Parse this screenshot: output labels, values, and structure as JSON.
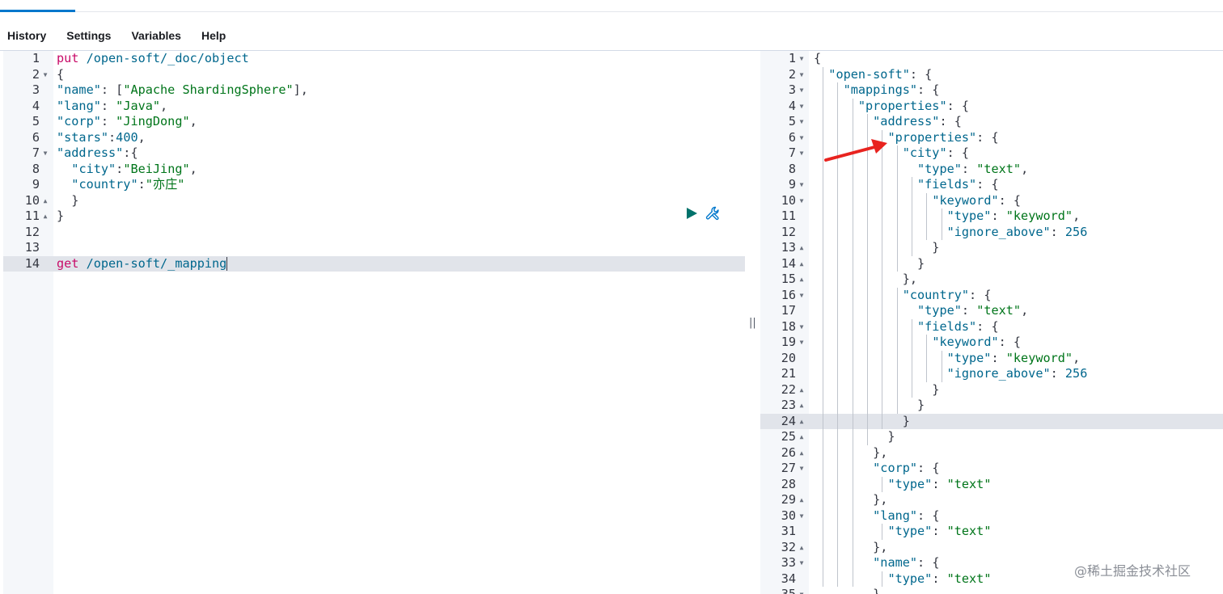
{
  "menu": {
    "history": "History",
    "settings": "Settings",
    "variables": "Variables",
    "help": "Help"
  },
  "request_editor": {
    "lines": [
      {
        "n": "1",
        "fold": "",
        "tokens": [
          [
            "tok-method",
            "put"
          ],
          [
            "tok-punc",
            " "
          ],
          [
            "tok-url",
            "/open-soft/_doc/object"
          ]
        ]
      },
      {
        "n": "2",
        "fold": "▼",
        "tokens": [
          [
            "tok-punc",
            "{"
          ]
        ]
      },
      {
        "n": "3",
        "fold": "",
        "tokens": [
          [
            "tok-key",
            "\"name\""
          ],
          [
            "tok-punc",
            ": ["
          ],
          [
            "tok-str",
            "\"Apache ShardingSphere\""
          ],
          [
            "tok-punc",
            "],"
          ]
        ]
      },
      {
        "n": "4",
        "fold": "",
        "tokens": [
          [
            "tok-key",
            "\"lang\""
          ],
          [
            "tok-punc",
            ": "
          ],
          [
            "tok-str",
            "\"Java\""
          ],
          [
            "tok-punc",
            ","
          ]
        ]
      },
      {
        "n": "5",
        "fold": "",
        "tokens": [
          [
            "tok-key",
            "\"corp\""
          ],
          [
            "tok-punc",
            ": "
          ],
          [
            "tok-str",
            "\"JingDong\""
          ],
          [
            "tok-punc",
            ","
          ]
        ]
      },
      {
        "n": "6",
        "fold": "",
        "tokens": [
          [
            "tok-key",
            "\"stars\""
          ],
          [
            "tok-punc",
            ":"
          ],
          [
            "tok-num",
            "400"
          ],
          [
            "tok-punc",
            ","
          ]
        ]
      },
      {
        "n": "7",
        "fold": "▼",
        "tokens": [
          [
            "tok-key",
            "\"address\""
          ],
          [
            "tok-punc",
            ":{"
          ]
        ]
      },
      {
        "n": "8",
        "fold": "",
        "tokens": [
          [
            "tok-punc",
            "  "
          ],
          [
            "tok-key",
            "\"city\""
          ],
          [
            "tok-punc",
            ":"
          ],
          [
            "tok-str",
            "\"BeiJing\""
          ],
          [
            "tok-punc",
            ","
          ]
        ]
      },
      {
        "n": "9",
        "fold": "",
        "tokens": [
          [
            "tok-punc",
            "  "
          ],
          [
            "tok-key",
            "\"country\""
          ],
          [
            "tok-punc",
            ":"
          ],
          [
            "tok-str",
            "\"亦庄\""
          ]
        ]
      },
      {
        "n": "10",
        "fold": "▲",
        "tokens": [
          [
            "tok-punc",
            "  }"
          ]
        ]
      },
      {
        "n": "11",
        "fold": "▲",
        "tokens": [
          [
            "tok-punc",
            "}"
          ]
        ]
      },
      {
        "n": "12",
        "fold": "",
        "tokens": []
      },
      {
        "n": "13",
        "fold": "",
        "tokens": []
      },
      {
        "n": "14",
        "fold": "",
        "tokens": [
          [
            "tok-method",
            "get"
          ],
          [
            "tok-punc",
            " "
          ],
          [
            "tok-url",
            "/open-soft/_mapping"
          ]
        ],
        "active": true
      }
    ]
  },
  "response_viewer": {
    "lines": [
      {
        "n": "1",
        "fold": "▼",
        "tokens": [
          [
            "tok-punc",
            "{"
          ]
        ]
      },
      {
        "n": "2",
        "fold": "▼",
        "tokens": [
          [
            "tok-punc",
            "  "
          ],
          [
            "tok-key",
            "\"open-soft\""
          ],
          [
            "tok-punc",
            ": {"
          ]
        ]
      },
      {
        "n": "3",
        "fold": "▼",
        "tokens": [
          [
            "tok-punc",
            "    "
          ],
          [
            "tok-key",
            "\"mappings\""
          ],
          [
            "tok-punc",
            ": {"
          ]
        ]
      },
      {
        "n": "4",
        "fold": "▼",
        "tokens": [
          [
            "tok-punc",
            "      "
          ],
          [
            "tok-key",
            "\"properties\""
          ],
          [
            "tok-punc",
            ": {"
          ]
        ]
      },
      {
        "n": "5",
        "fold": "▼",
        "tokens": [
          [
            "tok-punc",
            "        "
          ],
          [
            "tok-key",
            "\"address\""
          ],
          [
            "tok-punc",
            ": {"
          ]
        ]
      },
      {
        "n": "6",
        "fold": "▼",
        "tokens": [
          [
            "tok-punc",
            "          "
          ],
          [
            "tok-key",
            "\"properties\""
          ],
          [
            "tok-punc",
            ": {"
          ]
        ]
      },
      {
        "n": "7",
        "fold": "▼",
        "tokens": [
          [
            "tok-punc",
            "            "
          ],
          [
            "tok-key",
            "\"city\""
          ],
          [
            "tok-punc",
            ": {"
          ]
        ]
      },
      {
        "n": "8",
        "fold": "",
        "tokens": [
          [
            "tok-punc",
            "              "
          ],
          [
            "tok-key",
            "\"type\""
          ],
          [
            "tok-punc",
            ": "
          ],
          [
            "tok-str",
            "\"text\""
          ],
          [
            "tok-punc",
            ","
          ]
        ]
      },
      {
        "n": "9",
        "fold": "▼",
        "tokens": [
          [
            "tok-punc",
            "              "
          ],
          [
            "tok-key",
            "\"fields\""
          ],
          [
            "tok-punc",
            ": {"
          ]
        ]
      },
      {
        "n": "10",
        "fold": "▼",
        "tokens": [
          [
            "tok-punc",
            "                "
          ],
          [
            "tok-key",
            "\"keyword\""
          ],
          [
            "tok-punc",
            ": {"
          ]
        ]
      },
      {
        "n": "11",
        "fold": "",
        "tokens": [
          [
            "tok-punc",
            "                  "
          ],
          [
            "tok-key",
            "\"type\""
          ],
          [
            "tok-punc",
            ": "
          ],
          [
            "tok-str",
            "\"keyword\""
          ],
          [
            "tok-punc",
            ","
          ]
        ]
      },
      {
        "n": "12",
        "fold": "",
        "tokens": [
          [
            "tok-punc",
            "                  "
          ],
          [
            "tok-key",
            "\"ignore_above\""
          ],
          [
            "tok-punc",
            ": "
          ],
          [
            "tok-num",
            "256"
          ]
        ]
      },
      {
        "n": "13",
        "fold": "▲",
        "tokens": [
          [
            "tok-punc",
            "                }"
          ]
        ]
      },
      {
        "n": "14",
        "fold": "▲",
        "tokens": [
          [
            "tok-punc",
            "              }"
          ]
        ]
      },
      {
        "n": "15",
        "fold": "▲",
        "tokens": [
          [
            "tok-punc",
            "            },"
          ]
        ]
      },
      {
        "n": "16",
        "fold": "▼",
        "tokens": [
          [
            "tok-punc",
            "            "
          ],
          [
            "tok-key",
            "\"country\""
          ],
          [
            "tok-punc",
            ": {"
          ]
        ]
      },
      {
        "n": "17",
        "fold": "",
        "tokens": [
          [
            "tok-punc",
            "              "
          ],
          [
            "tok-key",
            "\"type\""
          ],
          [
            "tok-punc",
            ": "
          ],
          [
            "tok-str",
            "\"text\""
          ],
          [
            "tok-punc",
            ","
          ]
        ]
      },
      {
        "n": "18",
        "fold": "▼",
        "tokens": [
          [
            "tok-punc",
            "              "
          ],
          [
            "tok-key",
            "\"fields\""
          ],
          [
            "tok-punc",
            ": {"
          ]
        ]
      },
      {
        "n": "19",
        "fold": "▼",
        "tokens": [
          [
            "tok-punc",
            "                "
          ],
          [
            "tok-key",
            "\"keyword\""
          ],
          [
            "tok-punc",
            ": {"
          ]
        ]
      },
      {
        "n": "20",
        "fold": "",
        "tokens": [
          [
            "tok-punc",
            "                  "
          ],
          [
            "tok-key",
            "\"type\""
          ],
          [
            "tok-punc",
            ": "
          ],
          [
            "tok-str",
            "\"keyword\""
          ],
          [
            "tok-punc",
            ","
          ]
        ]
      },
      {
        "n": "21",
        "fold": "",
        "tokens": [
          [
            "tok-punc",
            "                  "
          ],
          [
            "tok-key",
            "\"ignore_above\""
          ],
          [
            "tok-punc",
            ": "
          ],
          [
            "tok-num",
            "256"
          ]
        ]
      },
      {
        "n": "22",
        "fold": "▲",
        "tokens": [
          [
            "tok-punc",
            "                }"
          ]
        ]
      },
      {
        "n": "23",
        "fold": "▲",
        "tokens": [
          [
            "tok-punc",
            "              }"
          ]
        ]
      },
      {
        "n": "24",
        "fold": "▲",
        "tokens": [
          [
            "tok-punc",
            "            }"
          ]
        ],
        "active": true
      },
      {
        "n": "25",
        "fold": "▲",
        "tokens": [
          [
            "tok-punc",
            "          }"
          ]
        ]
      },
      {
        "n": "26",
        "fold": "▲",
        "tokens": [
          [
            "tok-punc",
            "        },"
          ]
        ]
      },
      {
        "n": "27",
        "fold": "▼",
        "tokens": [
          [
            "tok-punc",
            "        "
          ],
          [
            "tok-key",
            "\"corp\""
          ],
          [
            "tok-punc",
            ": {"
          ]
        ]
      },
      {
        "n": "28",
        "fold": "",
        "tokens": [
          [
            "tok-punc",
            "          "
          ],
          [
            "tok-key",
            "\"type\""
          ],
          [
            "tok-punc",
            ": "
          ],
          [
            "tok-str",
            "\"text\""
          ]
        ]
      },
      {
        "n": "29",
        "fold": "▲",
        "tokens": [
          [
            "tok-punc",
            "        },"
          ]
        ]
      },
      {
        "n": "30",
        "fold": "▼",
        "tokens": [
          [
            "tok-punc",
            "        "
          ],
          [
            "tok-key",
            "\"lang\""
          ],
          [
            "tok-punc",
            ": {"
          ]
        ]
      },
      {
        "n": "31",
        "fold": "",
        "tokens": [
          [
            "tok-punc",
            "          "
          ],
          [
            "tok-key",
            "\"type\""
          ],
          [
            "tok-punc",
            ": "
          ],
          [
            "tok-str",
            "\"text\""
          ]
        ]
      },
      {
        "n": "32",
        "fold": "▲",
        "tokens": [
          [
            "tok-punc",
            "        },"
          ]
        ]
      },
      {
        "n": "33",
        "fold": "▼",
        "tokens": [
          [
            "tok-punc",
            "        "
          ],
          [
            "tok-key",
            "\"name\""
          ],
          [
            "tok-punc",
            ": {"
          ]
        ]
      },
      {
        "n": "34",
        "fold": "",
        "tokens": [
          [
            "tok-punc",
            "          "
          ],
          [
            "tok-key",
            "\"type\""
          ],
          [
            "tok-punc",
            ": "
          ],
          [
            "tok-str",
            "\"text\""
          ]
        ]
      },
      {
        "n": "35",
        "fold": "▼",
        "tokens": [
          [
            "tok-punc",
            "        }"
          ]
        ]
      }
    ]
  },
  "divider": {
    "handle": "||"
  },
  "watermark": "@稀土掘金技术社区",
  "colors": {
    "accent": "#0077cc",
    "run_button": "#00726b",
    "annotation_arrow": "#e8231f"
  },
  "icons": {
    "run": "play-triangle-icon",
    "settings": "wrench-icon",
    "annotation": "red-arrow-annotation"
  }
}
